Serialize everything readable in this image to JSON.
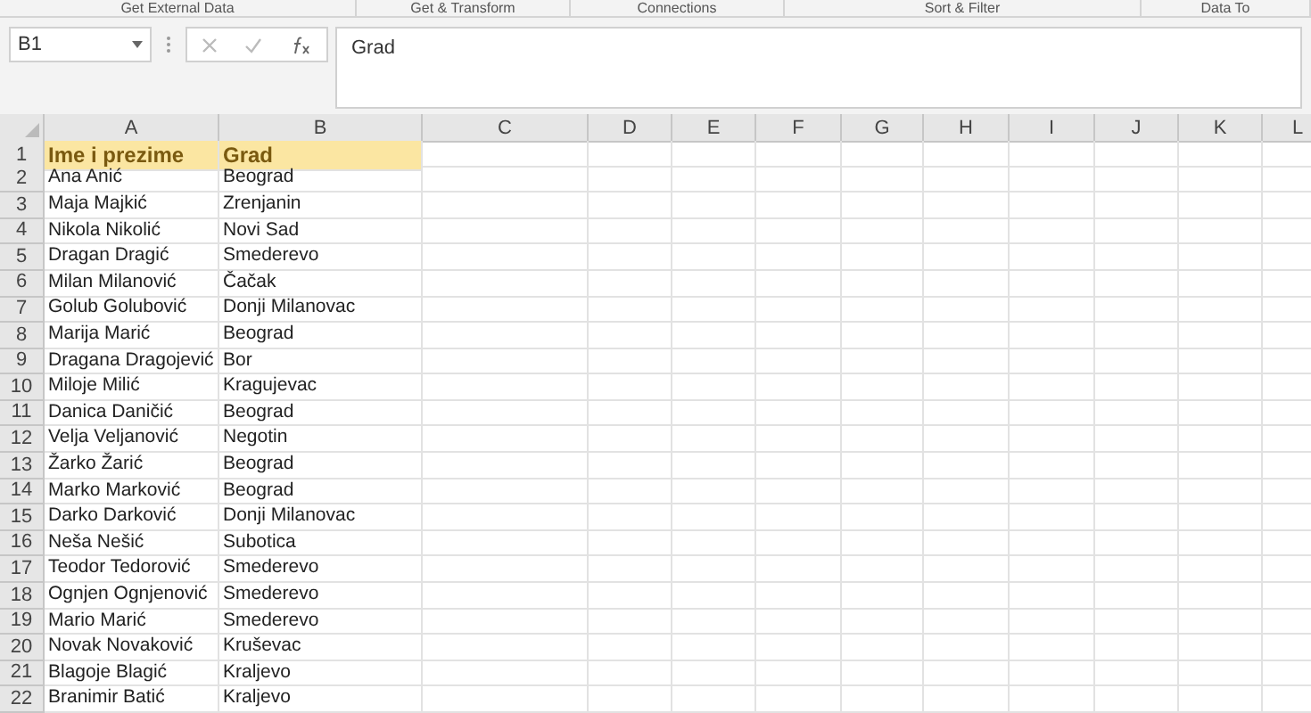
{
  "ribbon_groups": [
    "Get External Data",
    "Get & Transform",
    "Connections",
    "Sort & Filter",
    "Data To"
  ],
  "name_box": {
    "value": "B1"
  },
  "formula_bar": {
    "value": "Grad"
  },
  "columns": [
    "A",
    "B",
    "C",
    "D",
    "E",
    "F",
    "G",
    "H",
    "I",
    "J",
    "K",
    "L"
  ],
  "rows": [
    {
      "number": "1",
      "kind": "header",
      "cells": [
        "Ime i prezime",
        "Grad"
      ]
    },
    {
      "number": "2",
      "kind": "data",
      "cells": [
        "Ana Anić",
        "Beograd"
      ]
    },
    {
      "number": "3",
      "kind": "data",
      "cells": [
        "Maja Majkić",
        "Zrenjanin"
      ]
    },
    {
      "number": "4",
      "kind": "data",
      "cells": [
        "Nikola Nikolić",
        "Novi Sad"
      ]
    },
    {
      "number": "5",
      "kind": "data",
      "cells": [
        "Dragan Dragić",
        "Smederevo"
      ]
    },
    {
      "number": "6",
      "kind": "data",
      "cells": [
        "Milan Milanović",
        "Čačak"
      ]
    },
    {
      "number": "7",
      "kind": "data",
      "cells": [
        "Golub Golubović",
        "Donji Milanovac"
      ]
    },
    {
      "number": "8",
      "kind": "data",
      "cells": [
        "Marija Marić",
        "Beograd"
      ]
    },
    {
      "number": "9",
      "kind": "data",
      "cells": [
        "Dragana Dragojević",
        "Bor"
      ]
    },
    {
      "number": "10",
      "kind": "data",
      "cells": [
        "Miloje Milić",
        "Kragujevac"
      ]
    },
    {
      "number": "11",
      "kind": "data",
      "cells": [
        "Danica Daničić",
        "Beograd"
      ]
    },
    {
      "number": "12",
      "kind": "data",
      "cells": [
        "Velja Veljanović",
        "Negotin"
      ]
    },
    {
      "number": "13",
      "kind": "data",
      "cells": [
        "Žarko Žarić",
        "Beograd"
      ]
    },
    {
      "number": "14",
      "kind": "data",
      "cells": [
        "Marko Marković",
        "Beograd"
      ]
    },
    {
      "number": "15",
      "kind": "data",
      "cells": [
        "Darko Darković",
        "Donji Milanovac"
      ]
    },
    {
      "number": "16",
      "kind": "data",
      "cells": [
        "Neša Nešić",
        "Subotica"
      ]
    },
    {
      "number": "17",
      "kind": "data",
      "cells": [
        "Teodor Tedorović",
        "Smederevo"
      ]
    },
    {
      "number": "18",
      "kind": "data",
      "cells": [
        "Ognjen Ognjenović",
        "Smederevo"
      ]
    },
    {
      "number": "19",
      "kind": "data",
      "cells": [
        "Mario Marić",
        "Smederevo"
      ]
    },
    {
      "number": "20",
      "kind": "data",
      "cells": [
        "Novak Novaković",
        "Kruševac"
      ]
    },
    {
      "number": "21",
      "kind": "data",
      "cells": [
        "Blagoje Blagić",
        "Kraljevo"
      ]
    },
    {
      "number": "22",
      "kind": "data",
      "cells": [
        "Branimir Batić",
        "Kraljevo"
      ]
    }
  ]
}
